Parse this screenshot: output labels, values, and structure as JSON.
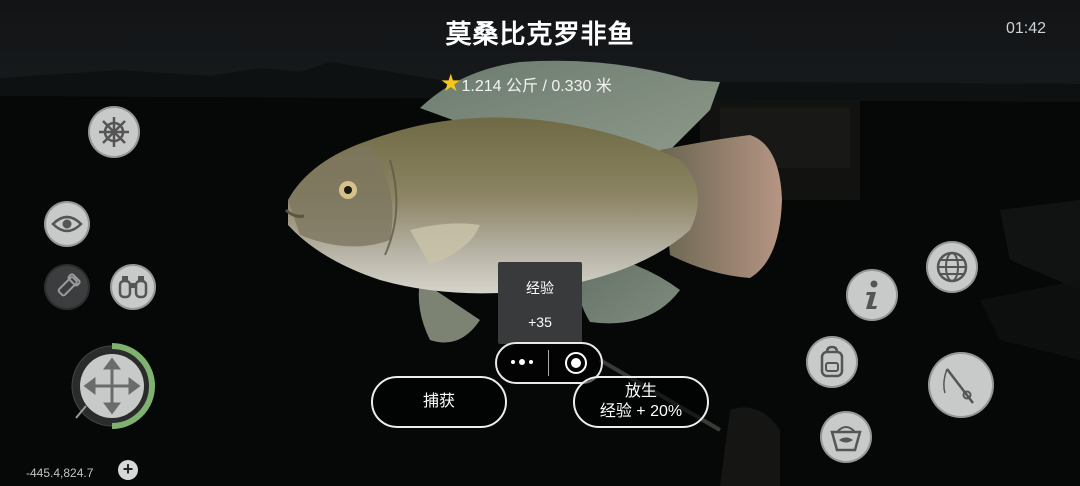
{
  "fish": {
    "name": "莫桑比克罗非鱼",
    "stats": "1.214 公斤 / 0.330 米"
  },
  "clock": "01:42",
  "coordinates": "-445.4,824.7",
  "xp_popup": {
    "label": "经验",
    "value": "+35"
  },
  "actions": {
    "keep_label": "捕获",
    "release_label": "放生",
    "release_sub": "经验 + 20%"
  },
  "hud_icons": {
    "left": [
      "ship-wheel-icon",
      "eye-icon",
      "flashlight-icon",
      "binoculars-icon",
      "move-joystick-icon"
    ],
    "right": [
      "globe-icon",
      "info-icon",
      "backpack-icon",
      "fishing-rod-icon",
      "bucket-icon"
    ]
  },
  "colors": {
    "star": "#f6c61b",
    "joystick_ring": "#7fb270",
    "button_fill": "#c8c9c9"
  }
}
